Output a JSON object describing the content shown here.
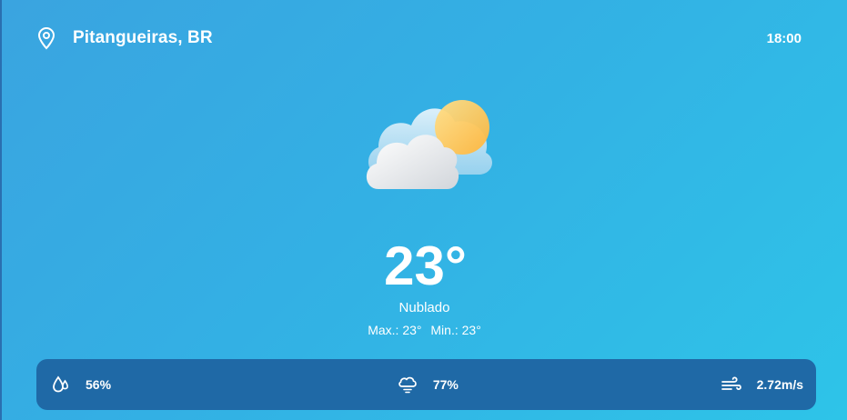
{
  "header": {
    "location": "Pitangueiras, BR",
    "time": "18:00",
    "location_icon": "map-pin-icon"
  },
  "current": {
    "icon": "partly-cloudy-icon",
    "temperature": "23°",
    "condition": "Nublado",
    "max_label": "Max.: 23°",
    "min_label": "Min.: 23°"
  },
  "stats": {
    "humidity": {
      "icon": "humidity-drops-icon",
      "value": "56%"
    },
    "clouds": {
      "icon": "cloud-rain-icon",
      "value": "77%"
    },
    "wind": {
      "icon": "wind-icon",
      "value": "2.72m/s"
    }
  },
  "colors": {
    "background_start": "#3aa4e0",
    "background_end": "#2ec4e8",
    "stats_bar": "#1f69a6",
    "text": "#ffffff",
    "sun": "#ffc94d"
  }
}
